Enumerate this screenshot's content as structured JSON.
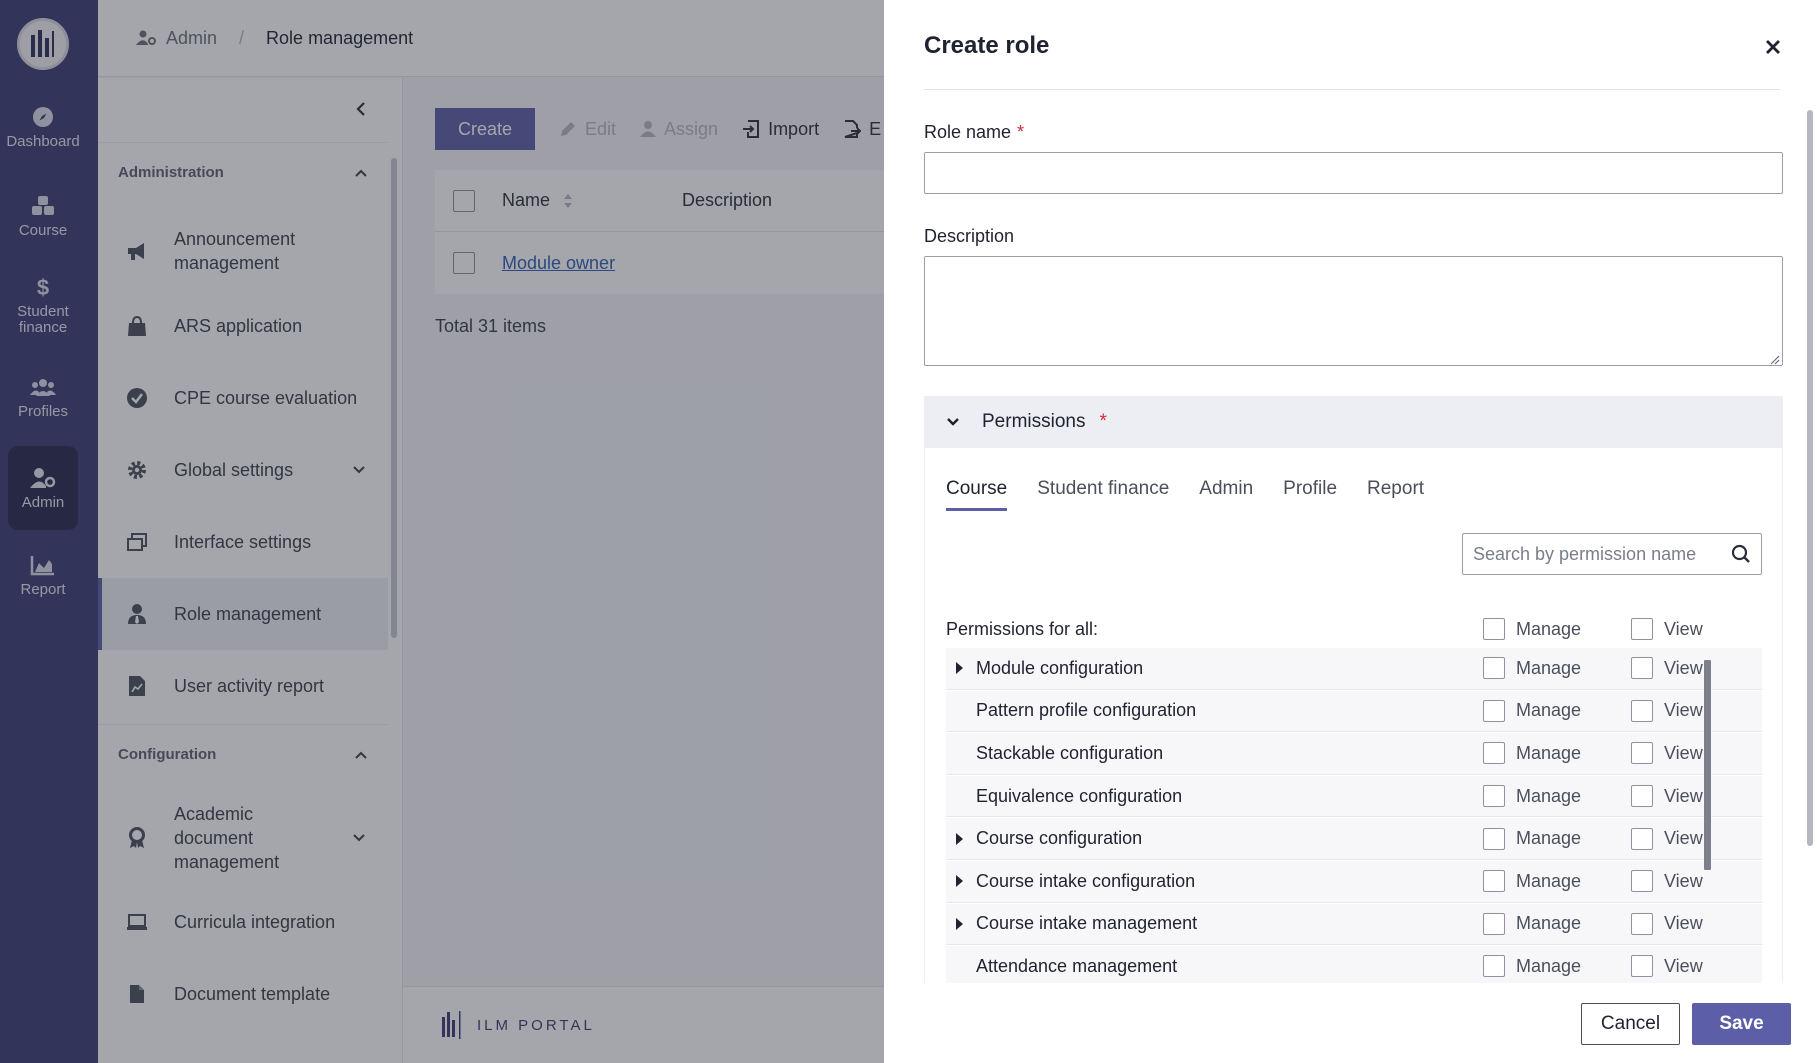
{
  "rail": {
    "items": [
      {
        "label": "Dashboard",
        "icon": "compass-icon"
      },
      {
        "label": "Course",
        "icon": "cubes-icon"
      },
      {
        "label": "Student finance",
        "icon": "dollar-icon"
      },
      {
        "label": "Profiles",
        "icon": "users-icon"
      },
      {
        "label": "Admin",
        "icon": "user-gear-icon",
        "active": true
      },
      {
        "label": "Report",
        "icon": "area-chart-icon"
      }
    ]
  },
  "breadcrumb": {
    "home": "Admin",
    "current": "Role management"
  },
  "sidebar": {
    "sections": [
      {
        "title": "Administration",
        "items": [
          {
            "label": "Announcement management",
            "icon": "megaphone-icon"
          },
          {
            "label": "ARS application",
            "icon": "shopping-bag-icon"
          },
          {
            "label": "CPE course evaluation",
            "icon": "check-circle-icon"
          },
          {
            "label": "Global settings",
            "icon": "gear-icon",
            "expandable": true
          },
          {
            "label": "Interface settings",
            "icon": "window-restore-icon"
          },
          {
            "label": "Role management",
            "icon": "user-tie-icon",
            "active": true
          },
          {
            "label": "User activity report",
            "icon": "file-chart-icon"
          }
        ]
      },
      {
        "title": "Configuration",
        "items": [
          {
            "label": "Academic document management",
            "icon": "award-icon",
            "expandable": true
          },
          {
            "label": "Curricula integration",
            "icon": "laptop-icon"
          },
          {
            "label": "Document template",
            "icon": "file-icon"
          }
        ]
      }
    ]
  },
  "toolbar": {
    "create": "Create",
    "edit": "Edit",
    "assign": "Assign",
    "import": "Import",
    "export": "E"
  },
  "table": {
    "headers": [
      "Name",
      "Description"
    ],
    "rows": [
      {
        "name": "Module owner",
        "description": ""
      }
    ],
    "total": "Total 31 items"
  },
  "footer": {
    "brand": "ILM PORTAL"
  },
  "drawer": {
    "title": "Create role",
    "role_name_label": "Role name",
    "role_name_value": "",
    "description_label": "Description",
    "description_value": "",
    "required_mark": "*",
    "permissions": {
      "title": "Permissions",
      "tabs": [
        "Course",
        "Student finance",
        "Admin",
        "Profile",
        "Report"
      ],
      "active_tab": "Course",
      "search_placeholder": "Search by permission name",
      "all_label": "Permissions for all:",
      "manage_label": "Manage",
      "view_label": "View",
      "rows": [
        {
          "name": "Module configuration",
          "expandable": true
        },
        {
          "name": "Pattern profile configuration",
          "expandable": false
        },
        {
          "name": "Stackable configuration",
          "expandable": false
        },
        {
          "name": "Equivalence configuration",
          "expandable": false
        },
        {
          "name": "Course configuration",
          "expandable": true
        },
        {
          "name": "Course intake configuration",
          "expandable": true
        },
        {
          "name": "Course intake management",
          "expandable": true
        },
        {
          "name": "Attendance management",
          "expandable": false
        }
      ]
    },
    "cancel": "Cancel",
    "save": "Save"
  },
  "colors": {
    "rail": "#3a3d73",
    "accent": "#5c5fa8",
    "link": "#2f5fb5",
    "required": "#d6293a"
  }
}
